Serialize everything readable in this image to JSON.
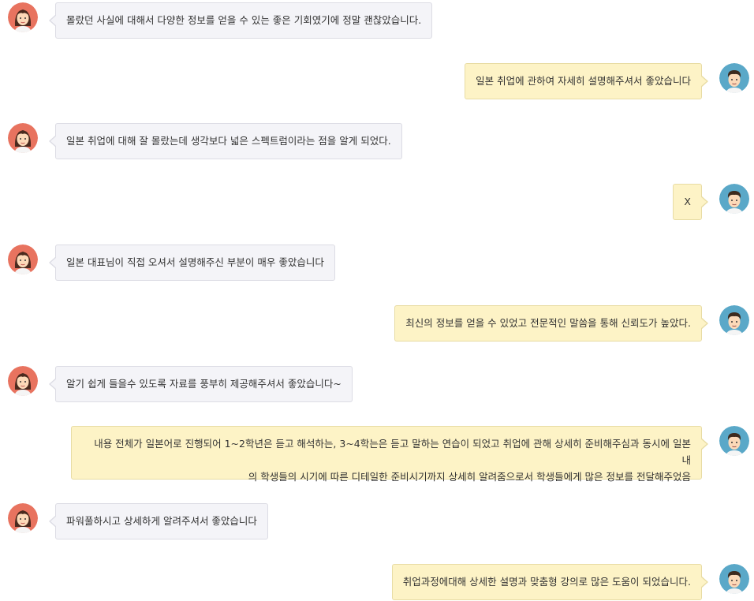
{
  "colors": {
    "left_bubble_bg": "#f4f4f8",
    "right_bubble_bg": "#fdf3c6",
    "female_avatar_bg": "#e8735f",
    "male_avatar_bg": "#5aa8c8"
  },
  "messages": [
    {
      "side": "left",
      "avatar": "female-avatar-icon",
      "text": "몰랐던 사실에 대해서 다양한 정보를 얻을 수 있는 좋은 기회였기에 정말 괜찮았습니다."
    },
    {
      "side": "right",
      "avatar": "male-avatar-icon",
      "text": "일본 취업에 관하여 자세히 설명해주셔서 좋았습니다"
    },
    {
      "side": "left",
      "avatar": "female-avatar-icon",
      "text": "일본 취업에 대해 잘 몰랐는데 생각보다 넓은 스펙트럼이라는 점을 알게 되었다."
    },
    {
      "side": "right",
      "avatar": "male-avatar-icon",
      "text": "X"
    },
    {
      "side": "left",
      "avatar": "female-avatar-icon",
      "text": "일본 대표님이 직접 오셔서 설명해주신 부분이 매우 좋았습니다"
    },
    {
      "side": "right",
      "avatar": "male-avatar-icon",
      "text": "최신의 정보를 얻을 수 있었고 전문적인 말씀을 통해 신뢰도가 높았다."
    },
    {
      "side": "left",
      "avatar": "female-avatar-icon",
      "text": "알기 쉽게 들을수 있도록 자료를 풍부히 제공해주셔서 좋았습니다~"
    },
    {
      "side": "right",
      "avatar": "male-avatar-icon",
      "text_lines": [
        "내용 전체가 일본어로 진행되어 1~2학년은 듣고 해석하는, 3~4학는은 듣고 말하는 연습이 되었고 취업에 관해 상세히 준비해주심과 동시에 일본 내",
        "의 학생들의 시기에 따른 디테일한 준비시기까지 상세히 알려줌으로서 학생들에게 많은 정보를 전달해주었음"
      ]
    },
    {
      "side": "left",
      "avatar": "female-avatar-icon",
      "text": "파워풀하시고 상세하게 알려주셔서 좋았습니다"
    },
    {
      "side": "right",
      "avatar": "male-avatar-icon",
      "text": "취업과정에대해 상세한 설명과 맞춤형 강의로 많은 도움이 되었습니다."
    }
  ]
}
